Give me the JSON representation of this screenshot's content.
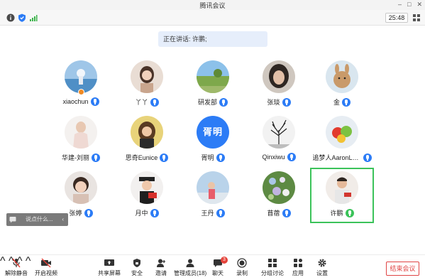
{
  "window": {
    "title": "腾讯会议"
  },
  "status": {
    "timer": "25:48"
  },
  "speaking": {
    "text": "正在讲话: 许鹏;"
  },
  "participants": [
    {
      "name": "xiaochun"
    },
    {
      "name": "丫丫"
    },
    {
      "name": "研发部"
    },
    {
      "name": "张琰"
    },
    {
      "name": "金"
    },
    {
      "name": "华建-刘丽"
    },
    {
      "name": "思奇Eunice"
    },
    {
      "name": "胥明",
      "avatar_text": "胥明"
    },
    {
      "name": "Qinxiwu"
    },
    {
      "name": "追梦人AaronLa..."
    },
    {
      "name": "张婷"
    },
    {
      "name": "月中"
    },
    {
      "name": "王丹"
    },
    {
      "name": "苜蓿"
    },
    {
      "name": "许鹏"
    }
  ],
  "chat": {
    "placeholder": "说点什么...",
    "arrow": "‹"
  },
  "toolbar": {
    "mute": "解除静音",
    "video": "开启视频",
    "share": "共享屏幕",
    "security": "安全",
    "invite": "邀请",
    "members": "管理成员(18)",
    "chat": "聊天",
    "chat_badge": "3",
    "record": "录制",
    "breakout": "分组讨论",
    "apps": "应用",
    "settings": "设置",
    "end": "结束会议"
  },
  "colors": {
    "accent": "#2c7cf6",
    "active_border": "#3bc35a",
    "end_red": "#e04444"
  }
}
